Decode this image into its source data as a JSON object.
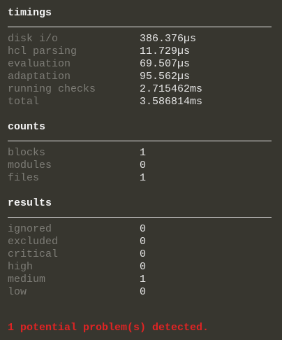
{
  "sections": [
    {
      "title": "timings",
      "rows": [
        {
          "label": "disk i/o",
          "value": "386.376µs"
        },
        {
          "label": "hcl parsing",
          "value": "11.729µs"
        },
        {
          "label": "evaluation",
          "value": "69.507µs"
        },
        {
          "label": "adaptation",
          "value": "95.562µs"
        },
        {
          "label": "running checks",
          "value": "2.715462ms"
        },
        {
          "label": "total",
          "value": "3.586814ms"
        }
      ]
    },
    {
      "title": "counts",
      "rows": [
        {
          "label": "blocks",
          "value": "1"
        },
        {
          "label": "modules",
          "value": "0"
        },
        {
          "label": "files",
          "value": "1"
        }
      ]
    },
    {
      "title": "results",
      "rows": [
        {
          "label": "ignored",
          "value": "0"
        },
        {
          "label": "excluded",
          "value": "0"
        },
        {
          "label": "critical",
          "value": "0"
        },
        {
          "label": "high",
          "value": "0"
        },
        {
          "label": "medium",
          "value": "1"
        },
        {
          "label": "low",
          "value": "0"
        }
      ]
    }
  ],
  "message": "1 potential problem(s) detected.",
  "colors": {
    "background": "#37362f",
    "error": "#e02424",
    "label": "#7d7c76"
  }
}
